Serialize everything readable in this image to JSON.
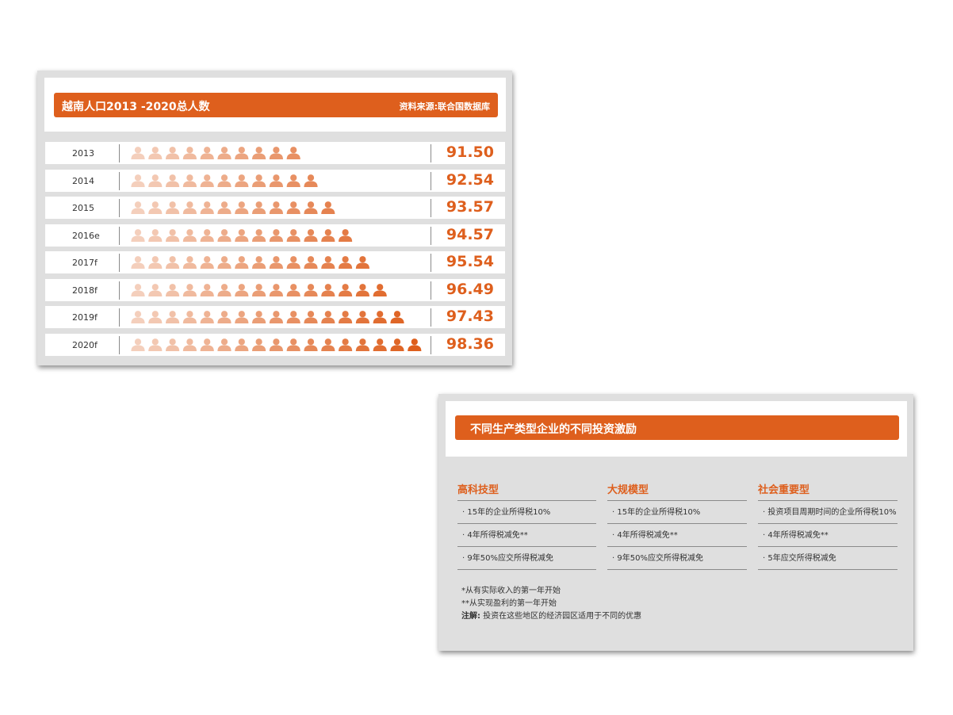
{
  "population": {
    "title": "越南人口2013 -2020总人数",
    "source": "资料来源:联合国数据库",
    "icon": "person-icon",
    "colors": {
      "accent": "#de5f1d",
      "light": "#f4cfbc"
    }
  },
  "chart_data": {
    "type": "table",
    "title": "越南人口2013 -2020总人数",
    "categories": [
      "2013",
      "2014",
      "2015",
      "2016e",
      "2017f",
      "2018f",
      "2019f",
      "2020f"
    ],
    "values": [
      "91.50",
      "92.54",
      "93.57",
      "94.57",
      "95.54",
      "96.49",
      "97.43",
      "98.36"
    ],
    "icon_counts": [
      10,
      11,
      12,
      13,
      14,
      15,
      16,
      17
    ]
  },
  "incentives": {
    "title": "不同生产类型企业的不同投资激励",
    "columns": [
      {
        "heading": "高科技型",
        "items": [
          "· 15年的企业所得税10%",
          "· 4年所得税减免**",
          "· 9年50%应交所得税减免"
        ]
      },
      {
        "heading": "大规模型",
        "items": [
          "· 15年的企业所得税10%",
          "· 4年所得税减免**",
          "· 9年50%应交所得税减免"
        ]
      },
      {
        "heading": "社会重要型",
        "items": [
          "· 投资项目周期时间的企业所得税10%",
          "· 4年所得税减免**",
          "· 5年应交所得税减免"
        ]
      }
    ],
    "notes": {
      "n1": "*从有实际收入的第一年开始",
      "n2": "**从实现盈利的第一年开始",
      "n3_label": "注解:",
      "n3_text": " 投资在这些地区的经济园区适用于不同的优惠"
    }
  }
}
